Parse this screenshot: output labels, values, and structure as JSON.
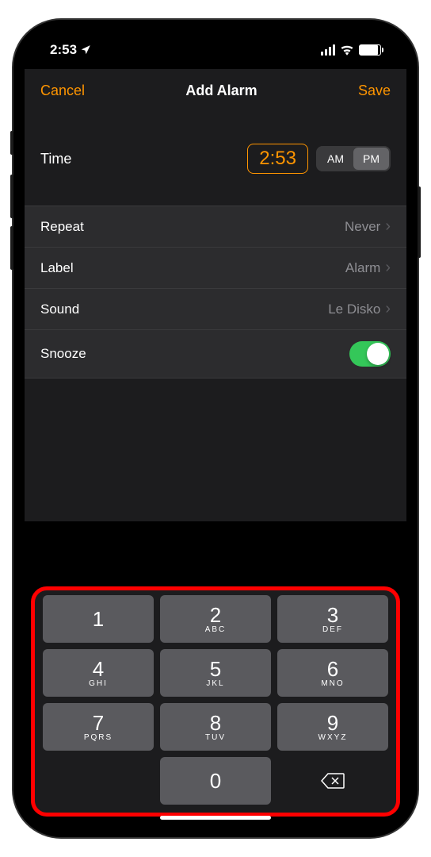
{
  "status": {
    "time": "2:53"
  },
  "nav": {
    "cancel": "Cancel",
    "title": "Add Alarm",
    "save": "Save"
  },
  "time_section": {
    "label": "Time",
    "value": "2:53",
    "am": "AM",
    "pm": "PM",
    "selected": "PM"
  },
  "settings": {
    "repeat": {
      "label": "Repeat",
      "value": "Never"
    },
    "label": {
      "label": "Label",
      "value": "Alarm"
    },
    "sound": {
      "label": "Sound",
      "value": "Le Disko"
    },
    "snooze": {
      "label": "Snooze",
      "enabled": true
    }
  },
  "keypad": {
    "keys": [
      {
        "digit": "1",
        "letters": ""
      },
      {
        "digit": "2",
        "letters": "ABC"
      },
      {
        "digit": "3",
        "letters": "DEF"
      },
      {
        "digit": "4",
        "letters": "GHI"
      },
      {
        "digit": "5",
        "letters": "JKL"
      },
      {
        "digit": "6",
        "letters": "MNO"
      },
      {
        "digit": "7",
        "letters": "PQRS"
      },
      {
        "digit": "8",
        "letters": "TUV"
      },
      {
        "digit": "9",
        "letters": "WXYZ"
      },
      {
        "digit": "",
        "letters": ""
      },
      {
        "digit": "0",
        "letters": ""
      }
    ]
  },
  "colors": {
    "accent": "#ff9500",
    "toggle_on": "#34c759",
    "highlight_border": "#ff0000"
  }
}
